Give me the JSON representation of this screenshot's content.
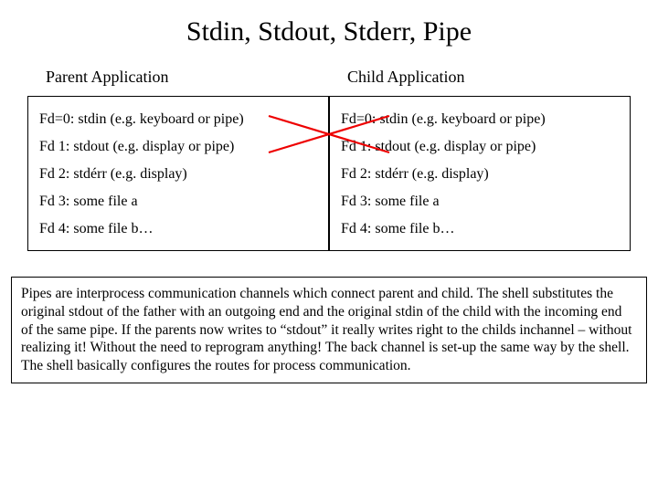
{
  "title": "Stdin, Stdout, Stderr, Pipe",
  "parent": {
    "header": "Parent Application",
    "items": [
      "Fd=0: stdin (e.g. keyboard or pipe)",
      "Fd 1: stdout (e.g. display or pipe)",
      "Fd 2: stdérr (e.g. display)",
      "Fd 3: some file a",
      "Fd 4: some file b…"
    ]
  },
  "child": {
    "header": "Child Application",
    "items": [
      "Fd=0: stdin (e.g. keyboard or pipe)",
      "Fd 1: stdout (e.g. display or pipe)",
      "Fd 2: stdérr (e.g. display)",
      "Fd 3: some file a",
      "Fd 4: some file b…"
    ]
  },
  "description": "Pipes are interprocess communication channels which connect parent and child. The shell substitutes the original stdout of the father with an outgoing end and the original stdin of the child with the incoming end of the same pipe. If the parents now writes to “stdout” it really writes right to the childs inchannel – without realizing it! Without the need to reprogram anything! The back channel is set-up the same way by the shell. The shell basically configures the routes for process communication.",
  "colors": {
    "cross": "#ee0000"
  }
}
